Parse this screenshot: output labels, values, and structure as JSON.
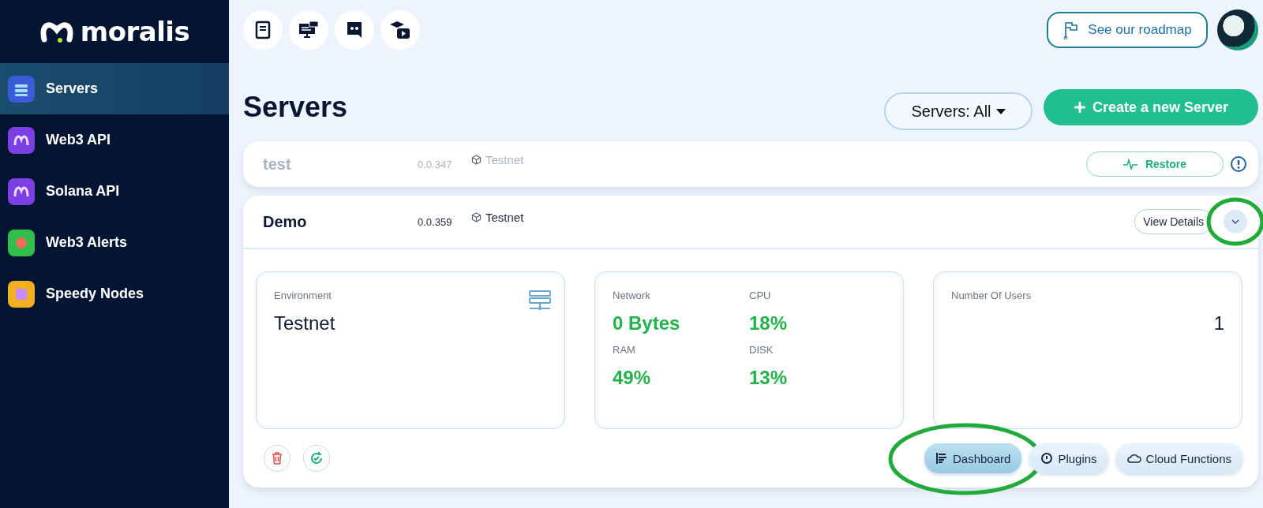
{
  "sidebar": {
    "logo": "moralis",
    "items": [
      {
        "label": "Servers",
        "selected": true,
        "color": "#3b5bdb"
      },
      {
        "label": "Web3 API",
        "selected": false,
        "color": "#7b3fe4"
      },
      {
        "label": "Solana API",
        "selected": false,
        "color": "#7b3fe4"
      },
      {
        "label": "Web3 Alerts",
        "selected": false,
        "color": "#2fbf4a"
      },
      {
        "label": "Speedy Nodes",
        "selected": false,
        "color": "#f2b01e"
      }
    ]
  },
  "toolbar": {
    "icons": [
      {
        "kind": "docs"
      },
      {
        "kind": "monitor"
      },
      {
        "kind": "chat"
      },
      {
        "kind": "academy"
      }
    ],
    "roadmap": "See our roadmap"
  },
  "header": {
    "title": "Servers",
    "filter": "Servers: All",
    "create": "Create a new Server"
  },
  "servers": [
    {
      "name": "test",
      "version": "0.0.347",
      "network": "Testnet",
      "disabled": true,
      "expanded": false,
      "action": {
        "kind": "restore",
        "label": "Restore"
      }
    },
    {
      "name": "Demo",
      "version": "0.0.359",
      "network": "Testnet",
      "disabled": false,
      "expanded": true,
      "circled": true,
      "action": {
        "kind": "details",
        "label": "View Details"
      },
      "details": {
        "environment": {
          "label": "Environment",
          "value": "Testnet"
        },
        "stats": [
          {
            "label": "Network",
            "value": "0 Bytes"
          },
          {
            "label": "CPU",
            "value": "18%"
          },
          {
            "label": "RAM",
            "value": "49%"
          },
          {
            "label": "DISK",
            "value": "13%"
          }
        ],
        "users": {
          "label": "Number Of Users",
          "value": "1"
        },
        "tools": [
          {
            "kind": "dashboard",
            "label": "Dashboard",
            "selected": true,
            "circled": true
          },
          {
            "kind": "plugins",
            "label": "Plugins",
            "selected": false,
            "circled": false
          },
          {
            "kind": "cloud",
            "label": "Cloud Functions",
            "selected": false,
            "circled": false
          }
        ]
      }
    }
  ]
}
